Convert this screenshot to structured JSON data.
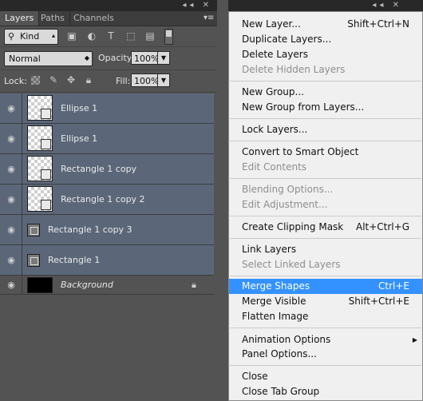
{
  "panel": {
    "tabs": [
      "Layers",
      "Paths",
      "Channels"
    ],
    "filter_kind": "Kind",
    "blend_mode": "Normal",
    "opacity_label": "Opacity:",
    "opacity_value": "100%",
    "lock_label": "Lock:",
    "fill_label": "Fill:",
    "fill_value": "100%"
  },
  "layers": [
    {
      "name": "Ellipse 1",
      "selected": true
    },
    {
      "name": "Ellipse 1",
      "selected": true
    },
    {
      "name": "Rectangle 1 copy",
      "selected": true
    },
    {
      "name": "Rectangle 1 copy 2",
      "selected": true
    },
    {
      "name": "Rectangle 1 copy 3",
      "selected": true
    },
    {
      "name": "Rectangle 1",
      "selected": true
    }
  ],
  "background_layer": {
    "name": "Background"
  },
  "menu": {
    "items": [
      {
        "label": "New Layer...",
        "shortcut": "Shift+Ctrl+N"
      },
      {
        "label": "Duplicate Layers..."
      },
      {
        "label": "Delete Layers"
      },
      {
        "label": "Delete Hidden Layers",
        "disabled": true
      },
      {
        "label": "New Group..."
      },
      {
        "label": "New Group from Layers..."
      },
      {
        "label": "Lock Layers..."
      },
      {
        "label": "Convert to Smart Object"
      },
      {
        "label": "Edit Contents",
        "disabled": true
      },
      {
        "label": "Blending Options...",
        "disabled": true
      },
      {
        "label": "Edit Adjustment...",
        "disabled": true
      },
      {
        "label": "Create Clipping Mask",
        "shortcut": "Alt+Ctrl+G"
      },
      {
        "label": "Link Layers"
      },
      {
        "label": "Select Linked Layers",
        "disabled": true
      },
      {
        "label": "Merge Shapes",
        "shortcut": "Ctrl+E",
        "highlighted": true
      },
      {
        "label": "Merge Visible",
        "shortcut": "Shift+Ctrl+E"
      },
      {
        "label": "Flatten Image"
      },
      {
        "label": "Animation Options",
        "submenu": true
      },
      {
        "label": "Panel Options..."
      },
      {
        "label": "Close"
      },
      {
        "label": "Close Tab Group"
      }
    ]
  },
  "colors": {
    "panel_bg": "#535353",
    "selected_layer": "#5b6779",
    "menu_bg": "#f0f0f0",
    "menu_highlight": "#3392ff"
  }
}
